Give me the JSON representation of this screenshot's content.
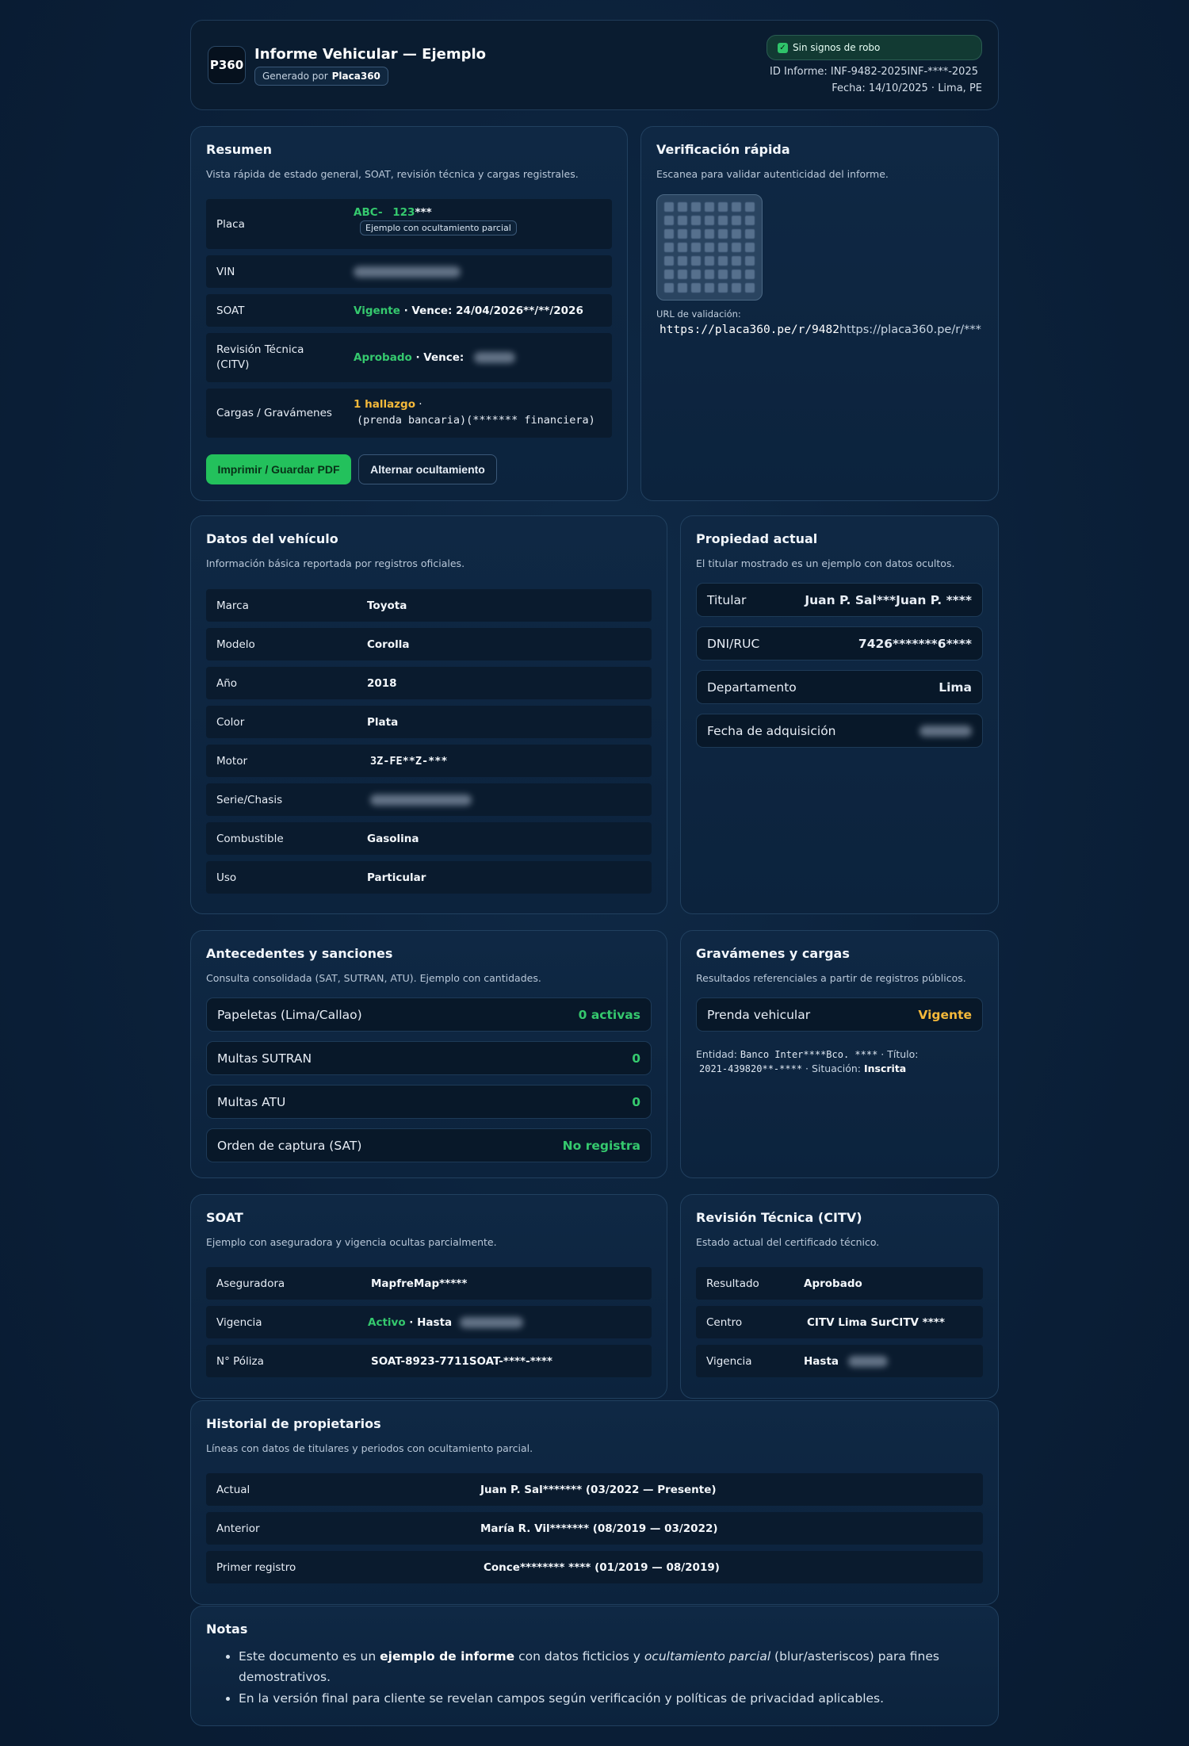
{
  "header": {
    "logo": "P360",
    "title": "Informe Vehicular — Ejemplo",
    "generated_prefix": "Generado por",
    "generated_by": "Placa360",
    "badge": "Sin signos de robo",
    "id_label": "ID Informe:",
    "id_value": "INF-9482-2025INF-****-2025",
    "date_line": "Fecha: 14/10/2025 · Lima, PE"
  },
  "resumen": {
    "title": "Resumen",
    "subtitle": "Vista rápida de estado general, SOAT, revisión técnica y cargas registrales.",
    "placa_label": "Placa",
    "placa_prefix": "ABC-",
    "placa_num": "123",
    "placa_mask": "***",
    "placa_hint": "Ejemplo con ocultamiento parcial",
    "vin_label": "VIN",
    "soat_label": "SOAT",
    "soat_status": "Vigente",
    "soat_vence": " · Vence: ",
    "soat_date": "24/04/2026**/**/2026",
    "rt_label": "Revisión Técnica (CITV)",
    "rt_status": "Aprobado",
    "rt_vence": " · Vence:",
    "cargas_label": "Cargas / Gravámenes",
    "cargas_status": "1 hallazgo",
    "cargas_sep": " ·",
    "cargas_detail": "(prenda bancaria)(******* financiera)",
    "btn_print": "Imprimir / Guardar PDF",
    "btn_toggle": "Alternar ocultamiento"
  },
  "verificacion": {
    "title": "Verificación rápida",
    "subtitle": "Escanea para validar autenticidad del informe.",
    "url_label": "URL de validación:",
    "url_value": "https://placa360.pe/r/9482",
    "url_masked": "https://placa360.pe/r/***"
  },
  "vehiculo": {
    "title": "Datos del vehículo",
    "subtitle": "Información básica reportada por registros oficiales.",
    "rows": [
      {
        "k": "Marca",
        "v": "Toyota"
      },
      {
        "k": "Modelo",
        "v": "Corolla"
      },
      {
        "k": "Año",
        "v": "2018"
      },
      {
        "k": "Color",
        "v": "Plata"
      },
      {
        "k": "Motor",
        "v": "3Z-FE**Z-***"
      },
      {
        "k": "Serie/Chasis",
        "v": ""
      },
      {
        "k": "Combustible",
        "v": "Gasolina"
      },
      {
        "k": "Uso",
        "v": "Particular"
      }
    ]
  },
  "propiedad": {
    "title": "Propiedad actual",
    "subtitle": "El titular mostrado es un ejemplo con datos ocultos.",
    "rows": [
      {
        "k": "Titular",
        "v": "Juan P. Sal***Juan P. ****"
      },
      {
        "k": "DNI/RUC",
        "v": "7426*******6****"
      },
      {
        "k": "Departamento",
        "v": "Lima"
      },
      {
        "k": "Fecha de adquisición",
        "v": ""
      }
    ]
  },
  "antecedentes": {
    "title": "Antecedentes y sanciones",
    "subtitle": "Consulta consolidada (SAT, SUTRAN, ATU). Ejemplo con cantidades.",
    "rows": [
      {
        "k": "Papeletas (Lima/Callao)",
        "v": "0 activas"
      },
      {
        "k": "Multas SUTRAN",
        "v": "0"
      },
      {
        "k": "Multas ATU",
        "v": "0"
      },
      {
        "k": "Orden de captura (SAT)",
        "v": "No registra"
      }
    ]
  },
  "gravamenes": {
    "title": "Gravámenes y cargas",
    "subtitle": "Resultados referenciales a partir de registros públicos.",
    "row_k": "Prenda vehicular",
    "row_v": "Vigente",
    "entidad_label": "Entidad:",
    "entidad_value": "Banco Inter****Bco. ****",
    "titulo_label": " · Título:",
    "titulo_value": "2021-439820**-****",
    "situacion_label": " · Situación:",
    "situacion_value": "Inscrita"
  },
  "soat": {
    "title": "SOAT",
    "subtitle": "Ejemplo con aseguradora y vigencia ocultas parcialmente.",
    "aseg_label": "Aseguradora",
    "aseg_value": "MapfreMap*****",
    "vig_label": "Vigencia",
    "vig_status": "Activo",
    "vig_hasta": " · Hasta",
    "poliza_label": "N° Póliza",
    "poliza_value": "SOAT-8923-7711SOAT-****-****"
  },
  "citv": {
    "title": "Revisión Técnica (CITV)",
    "subtitle": "Estado actual del certificado técnico.",
    "res_label": "Resultado",
    "res_value": "Aprobado",
    "centro_label": "Centro",
    "centro_value": "CITV Lima SurCITV ****",
    "vig_label": "Vigencia",
    "vig_value": "Hasta"
  },
  "historial": {
    "title": "Historial de propietarios",
    "subtitle": "Líneas con datos de titulares y periodos con ocultamiento parcial.",
    "rows": [
      {
        "k": "Actual",
        "name": "Juan P.  Sal*******",
        "period": "(03/2022 — Presente)"
      },
      {
        "k": "Anterior",
        "name": "María R.  Vil*******",
        "period": "(08/2019 — 03/2022)"
      },
      {
        "k": "Primer registro",
        "name": "Conce******** ****",
        "period": "(01/2019 — 08/2019)"
      }
    ]
  },
  "notas": {
    "title": "Notas",
    "n1_a": "Este documento es un ",
    "n1_b": "ejemplo de informe",
    "n1_c": " con datos ficticios y ",
    "n1_d": "ocultamiento parcial",
    "n1_e": " (blur/asteriscos) para fines demostrativos.",
    "n2": "En la versión final para cliente se revelan campos según verificación y políticas de privacidad aplicables."
  },
  "colors": {
    "background": "#0b2039",
    "card": "#0f2844",
    "accent_green": "#23c15c",
    "status_green": "#35c96e",
    "status_yellow": "#f5b93a"
  }
}
